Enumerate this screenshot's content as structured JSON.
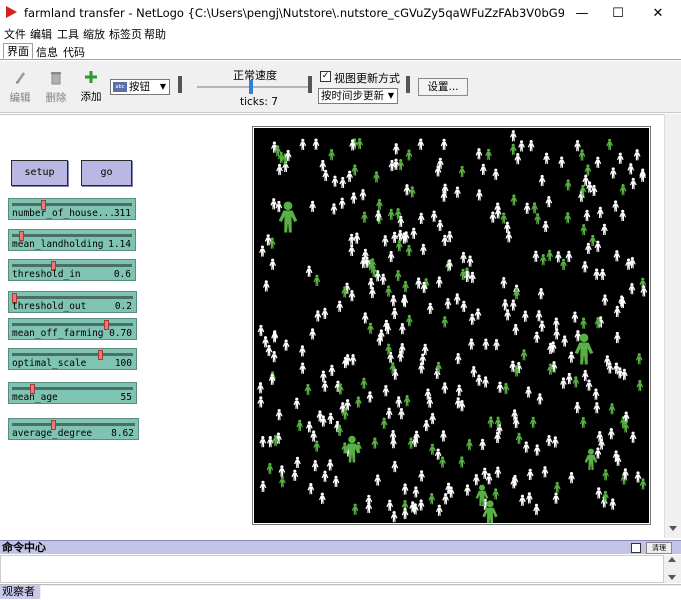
{
  "window": {
    "title": "farmland transfer - NetLogo {C:\\Users\\pengj\\Nutstore\\.nutstore_cGVuZy5qaWFuZzFAb3V0bG9vay5jb20=\\P...",
    "minimize": "—",
    "maximize": "☐",
    "close": "✕"
  },
  "menu": [
    "文件",
    "编辑",
    "工具",
    "缩放",
    "标签页",
    "帮助"
  ],
  "tabs": [
    "界面",
    "信息",
    "代码"
  ],
  "toolbar": {
    "edit_label": "编辑",
    "delete_label": "删除",
    "add_label": "添加",
    "widget_type": "按钮",
    "speed_label": "正常速度",
    "speed_level": 0.48,
    "ticks_text": "ticks: 7",
    "view_updates_label": "视图更新方式",
    "view_updates_checked": "✓",
    "update_mode": "按时间步更新",
    "settings_label": "设置..."
  },
  "buttons": {
    "setup": "setup",
    "go": "go"
  },
  "sliders": [
    {
      "name": "number_of_house...",
      "value": "311",
      "fraction": 0.25
    },
    {
      "name": "mean_landholding",
      "value": "1.14",
      "fraction": 0.06
    },
    {
      "name": "threshold_in",
      "value": "0.6",
      "fraction": 0.34
    },
    {
      "name": "threshold_out",
      "value": "0.2",
      "fraction": 0.0
    },
    {
      "name": "mean_off_farming",
      "value": "0.70",
      "fraction": 0.8
    },
    {
      "name": "optimal_scale",
      "value": "100",
      "fraction": 0.75
    },
    {
      "name": "mean_age",
      "value": "55",
      "fraction": 0.16
    },
    {
      "name": "average_degree",
      "value": "8.62",
      "fraction": 0.33
    }
  ],
  "world": {
    "background": "#000000",
    "agent_colors": {
      "white": "#ffffff",
      "green": "#59b043"
    }
  },
  "command_center": {
    "title": "命令中心",
    "clear_label": "清理",
    "observer_label": "观察者"
  },
  "colors": {
    "button_bg": "#b8b8e3",
    "slider_bg": "#7fc4b3",
    "slider_thumb": "#f07777",
    "accent_green": "#2a9b2a"
  }
}
